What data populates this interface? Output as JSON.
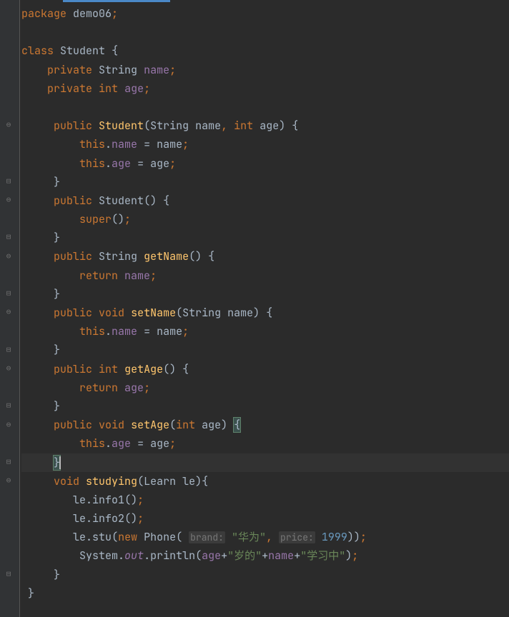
{
  "tab_active": true,
  "code": {
    "l1": {
      "kw1": "package",
      "sp": " ",
      "pkg": "demo06",
      "semi": ";"
    },
    "l3": {
      "kw1": "class",
      "name": "Student",
      "br": "{"
    },
    "l4": {
      "kw1": "private",
      "type": "String",
      "field": "name",
      "semi": ";"
    },
    "l5": {
      "kw1": "private",
      "kw2": "int",
      "field": "age",
      "semi": ";"
    },
    "l7": {
      "kw1": "public",
      "name": "Student",
      "p1": "(",
      "type1": "String",
      "arg1": "name",
      "comma": ",",
      "kw2": "int",
      "arg2": "age",
      "p2": ")",
      "br": "{"
    },
    "l8": {
      "kw1": "this",
      "dot": ".",
      "field": "name",
      "eq": " = ",
      "arg": "name",
      "semi": ";"
    },
    "l9": {
      "kw1": "this",
      "dot": ".",
      "field": "age",
      "eq": " = ",
      "arg": "age",
      "semi": ";"
    },
    "l10": {
      "br": "}"
    },
    "l11": {
      "kw1": "public",
      "name": "Student",
      "p": "()",
      "br": "{"
    },
    "l12": {
      "kw1": "super",
      "p": "()",
      "semi": ";"
    },
    "l13": {
      "br": "}"
    },
    "l14": {
      "kw1": "public",
      "type": "String",
      "name": "getName",
      "p": "()",
      "br": "{"
    },
    "l15": {
      "kw1": "return",
      "field": "name",
      "semi": ";"
    },
    "l16": {
      "br": "}"
    },
    "l17": {
      "kw1": "public",
      "kw2": "void",
      "name": "setName",
      "p1": "(",
      "type": "String",
      "arg": "name",
      "p2": ")",
      "br": "{"
    },
    "l18": {
      "kw1": "this",
      "dot": ".",
      "field": "name",
      "eq": " = ",
      "arg": "name",
      "semi": ";"
    },
    "l19": {
      "br": "}"
    },
    "l20": {
      "kw1": "public",
      "kw2": "int",
      "name": "getAge",
      "p": "()",
      "br": "{"
    },
    "l21": {
      "kw1": "return",
      "field": "age",
      "semi": ";"
    },
    "l22": {
      "br": "}"
    },
    "l23": {
      "kw1": "public",
      "kw2": "void",
      "name": "setAge",
      "p1": "(",
      "kw3": "int",
      "arg": "age",
      "p2": ")",
      "br": "{"
    },
    "l24": {
      "kw1": "this",
      "dot": ".",
      "field": "age",
      "eq": " = ",
      "arg": "age",
      "semi": ";"
    },
    "l25": {
      "br": "}"
    },
    "l26": {
      "kw1": "void",
      "name": "studying",
      "p1": "(",
      "type": "Learn",
      "arg": "le",
      "p2": ")",
      "br": "{"
    },
    "l27": {
      "obj": "le",
      "dot": ".",
      "method": "info1",
      "p": "()",
      "semi": ";"
    },
    "l28": {
      "obj": "le",
      "dot": ".",
      "method": "info2",
      "p": "()",
      "semi": ";"
    },
    "l29": {
      "obj": "le",
      "dot": ".",
      "method": "stu",
      "p1": "(",
      "kw1": "new",
      "cls": "Phone",
      "p2": "(",
      "hint1": "brand:",
      "str1": "\"华为\"",
      "comma": ",",
      "hint2": "price:",
      "num": "1999",
      "p3": "))",
      "semi": ";"
    },
    "l30": {
      "cls": "System",
      "dot1": ".",
      "field1": "out",
      "dot2": ".",
      "method": "println",
      "p1": "(",
      "f1": "age",
      "plus1": "+",
      "str1": "\"岁的\"",
      "plus2": "+",
      "f2": "name",
      "plus3": "+",
      "str2": "\"学习中\"",
      "p2": ")",
      "semi": ";"
    },
    "l31": {
      "br": "}"
    },
    "l32": {
      "br": "}"
    }
  }
}
